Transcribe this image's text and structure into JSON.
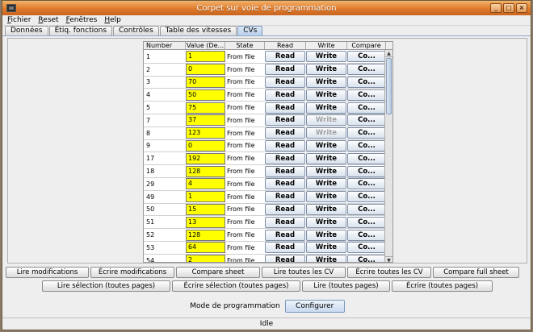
{
  "window": {
    "title": "Corpet sur voie de programmation"
  },
  "menu": [
    "Fichier",
    "Reset",
    "Fenêtres",
    "Help"
  ],
  "tabs": [
    {
      "label": "Données",
      "active": false
    },
    {
      "label": "Étiq. fonctions",
      "active": false
    },
    {
      "label": "Contrôles",
      "active": false
    },
    {
      "label": "Table des vitesses",
      "active": false
    },
    {
      "label": "CVs",
      "active": true
    }
  ],
  "table": {
    "headers": [
      "Number",
      "Value (De...",
      "State",
      "Read",
      "Write",
      "Compare"
    ],
    "read_label": "Read",
    "write_label": "Write",
    "compare_label": "Co...",
    "rows": [
      {
        "number": "1",
        "value": "1",
        "state": "From file",
        "write_enabled": true
      },
      {
        "number": "2",
        "value": "0",
        "state": "From file",
        "write_enabled": true
      },
      {
        "number": "3",
        "value": "70",
        "state": "From file",
        "write_enabled": true
      },
      {
        "number": "4",
        "value": "50",
        "state": "From file",
        "write_enabled": true
      },
      {
        "number": "5",
        "value": "75",
        "state": "From file",
        "write_enabled": true
      },
      {
        "number": "7",
        "value": "37",
        "state": "From file",
        "write_enabled": false
      },
      {
        "number": "8",
        "value": "123",
        "state": "From file",
        "write_enabled": false
      },
      {
        "number": "9",
        "value": "0",
        "state": "From file",
        "write_enabled": true
      },
      {
        "number": "17",
        "value": "192",
        "state": "From file",
        "write_enabled": true
      },
      {
        "number": "18",
        "value": "128",
        "state": "From file",
        "write_enabled": true
      },
      {
        "number": "29",
        "value": "4",
        "state": "From file",
        "write_enabled": true
      },
      {
        "number": "49",
        "value": "1",
        "state": "From file",
        "write_enabled": true
      },
      {
        "number": "50",
        "value": "15",
        "state": "From file",
        "write_enabled": true
      },
      {
        "number": "51",
        "value": "13",
        "state": "From file",
        "write_enabled": true
      },
      {
        "number": "52",
        "value": "128",
        "state": "From file",
        "write_enabled": true
      },
      {
        "number": "53",
        "value": "64",
        "state": "From file",
        "write_enabled": true
      },
      {
        "number": "54",
        "value": "2",
        "state": "From file",
        "write_enabled": true
      }
    ]
  },
  "actions_row1": [
    "Lire modifications",
    "Écrire modifications",
    "Compare sheet",
    "Lire toutes les CV",
    "Écrire toutes les CV",
    "Compare full sheet"
  ],
  "actions_row2": [
    "Lire sélection (toutes pages)",
    "Écrire sélection (toutes pages)",
    "Lire (toutes pages)",
    "Écrire (toutes pages)"
  ],
  "mode": {
    "label": "Mode de programmation",
    "button": "Configurer"
  },
  "status": "Idle"
}
